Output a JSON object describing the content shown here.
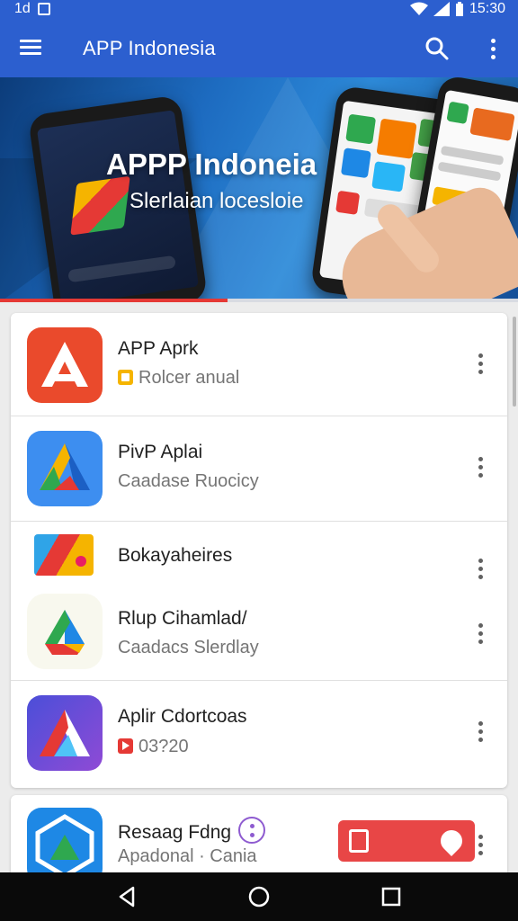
{
  "status_bar": {
    "left_text": "1d",
    "time": "15:30"
  },
  "app_bar": {
    "title": "APP Indonesia"
  },
  "banner": {
    "title": "APPP Indoneia",
    "subtitle": "Slerlaian locesloie",
    "progress": 0.44
  },
  "list": [
    {
      "title": "APP Aprk",
      "subtitle": "Rolcer anual",
      "badge": "yellow"
    },
    {
      "title": "PivP Aplai",
      "subtitle": "Caadase Ruocicy"
    },
    {
      "title": "Bokayaheires"
    },
    {
      "title": "Rlup Cihamlad/",
      "subtitle": "Caadacs Slerdlay"
    },
    {
      "title": "Aplir Cdortcoas",
      "subtitle": "03?20",
      "badge": "red"
    }
  ],
  "bottom_item": {
    "title": "Resaag Fdng",
    "subtitle": "Apadonal · Cania"
  },
  "colors": {
    "primary": "#2c5fcf",
    "accent": "#e53935"
  }
}
